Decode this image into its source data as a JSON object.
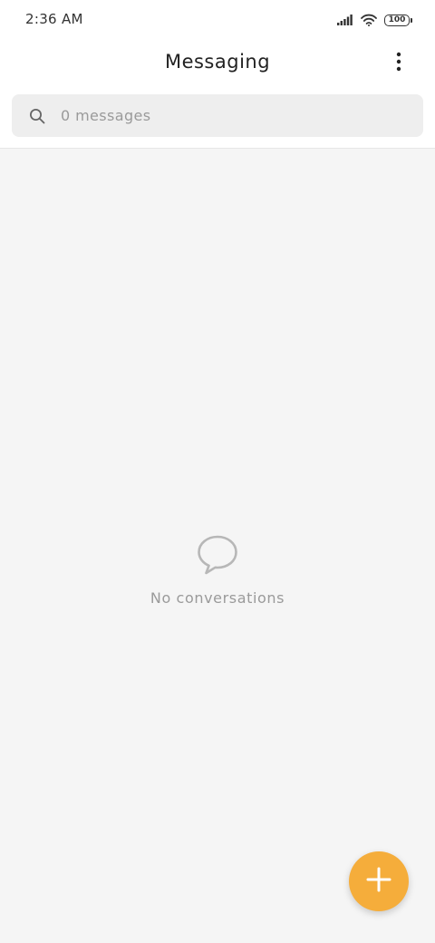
{
  "status_bar": {
    "time": "2:36 AM",
    "battery_level": "100",
    "icons": [
      "signal-icon",
      "wifi-icon",
      "battery-icon"
    ]
  },
  "header": {
    "title": "Messaging",
    "menu_icon": "more-vertical-icon"
  },
  "search": {
    "placeholder": "0 messages",
    "value": "",
    "icon": "search-icon"
  },
  "empty_state": {
    "icon": "chat-bubble-icon",
    "text": "No conversations"
  },
  "fab": {
    "icon": "plus-icon",
    "color": "#f5ad3b"
  },
  "colors": {
    "background": "#f5f5f5",
    "accent": "#f5ad3b",
    "search_bg": "#eeeeee"
  }
}
